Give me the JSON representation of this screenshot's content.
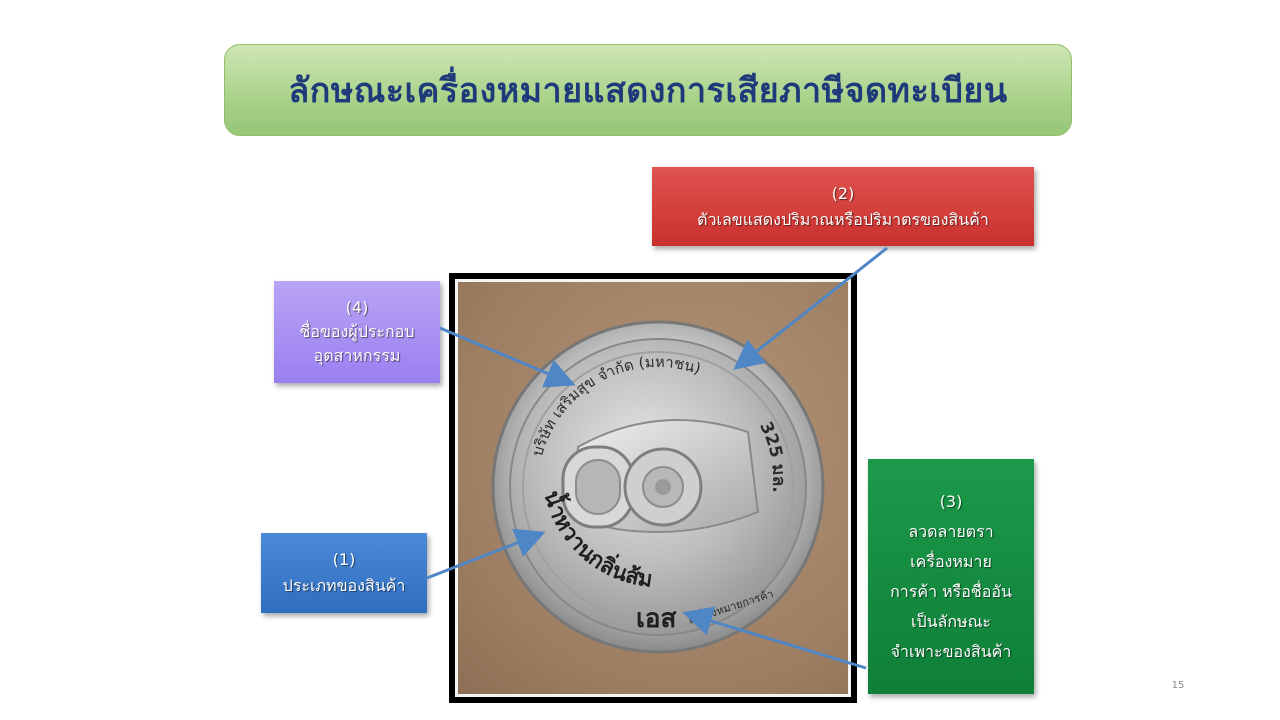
{
  "title": "ลักษณะเครื่องหมายแสดงการเสียภาษีจดทะเบียน",
  "callouts": {
    "c1": {
      "num": "(1)",
      "lines": [
        "ประเภทของสินค้า"
      ]
    },
    "c2": {
      "num": "(2)",
      "lines": [
        "ตัวเลขแสดงปริมาณหรือปริมาตรของสินค้า"
      ]
    },
    "c3": {
      "num": "(3)",
      "lines": [
        "ลวดลายตรา",
        "เครื่องหมาย",
        "การค้า หรือชื่ออัน",
        "เป็นลักษณะ",
        "จำเพาะของสินค้า"
      ]
    },
    "c4": {
      "num": "(4)",
      "lines": [
        "ชื่อของผู้ประกอบ",
        "อุตสาหกรรม"
      ]
    }
  },
  "can_label": {
    "top_arc": "บริษัท เสริมสุข จำกัด (มหาชน)",
    "volume": "325 มล.",
    "left_arc": "น้ำหวานกลิ่นส้ม",
    "brand": "เอส",
    "trademark_arc": "เครื่องหมายการค้า"
  },
  "page_number": "15",
  "colors": {
    "title_text": "#1f3a7a",
    "c1": "#2f6dbf",
    "c2": "#c9302c",
    "c3": "#0e7f38",
    "c4": "#9a7ff0",
    "arrow": "#4f86c6"
  }
}
